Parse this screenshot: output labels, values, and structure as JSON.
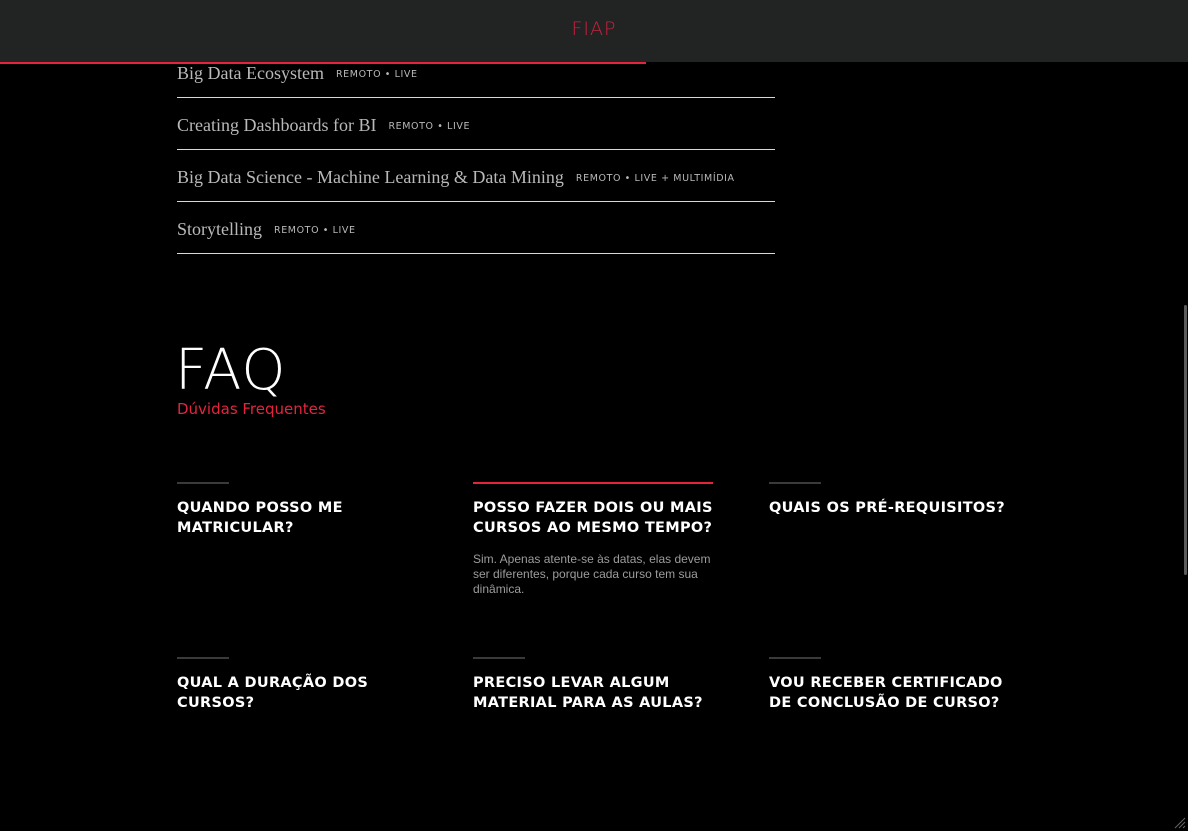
{
  "header": {
    "logo_text": "FIAP",
    "progress_percent": 54.4,
    "accent_color": "#e4243f"
  },
  "courses": [
    {
      "name": "Big Data Ecosystem",
      "mode": "REMOTO • LIVE"
    },
    {
      "name": "Creating Dashboards for BI",
      "mode": "REMOTO • LIVE"
    },
    {
      "name": "Big Data Science - Machine Learning & Data Mining",
      "mode": "REMOTO • LIVE + MULTIMÍDIA"
    },
    {
      "name": "Storytelling",
      "mode": "REMOTO • LIVE"
    }
  ],
  "faq": {
    "title": "FAQ",
    "subtitle": "Dúvidas Frequentes",
    "items": [
      {
        "question": "QUANDO POSSO ME MATRICULAR?",
        "answer": ""
      },
      {
        "question": "POSSO FAZER DOIS OU MAIS CURSOS AO MESMO TEMPO?",
        "answer": "Sim. Apenas atente-se às datas, elas devem ser diferentes, porque cada curso tem sua dinâmica."
      },
      {
        "question": "QUAIS OS PRÉ-REQUISITOS?",
        "answer": ""
      },
      {
        "question": "QUAL A DURAÇÃO DOS CURSOS?",
        "answer": ""
      },
      {
        "question": "PRECISO LEVAR ALGUM MATERIAL PARA AS AULAS?",
        "answer": ""
      },
      {
        "question": "VOU RECEBER CERTIFICADO DE CONCLUSÃO DE CURSO?",
        "answer": ""
      }
    ]
  }
}
